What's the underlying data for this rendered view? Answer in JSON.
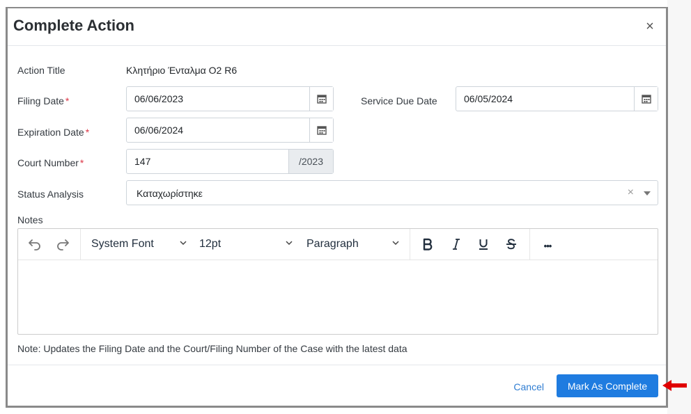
{
  "dialog": {
    "title": "Complete Action",
    "close_glyph": "×"
  },
  "form": {
    "action_title_label": "Action Title",
    "action_title_value": "Κλητήριο Ένταλμα Ο2 R6",
    "filing_date_label": "Filing Date",
    "filing_date_value": "06/06/2023",
    "service_due_date_label": "Service Due Date",
    "service_due_date_value": "06/05/2024",
    "expiration_date_label": "Expiration Date",
    "expiration_date_value": "06/06/2024",
    "court_number_label": "Court Number",
    "court_number_value": "147",
    "court_number_suffix": "/2023",
    "status_analysis_label": "Status Analysis",
    "status_analysis_value": "Καταχωρίστηκε",
    "clear_glyph": "×",
    "required_mark": "*",
    "notes_label": "Notes"
  },
  "editor": {
    "font_family": "System Font",
    "font_size": "12pt",
    "block_format": "Paragraph",
    "more_glyph": "•••",
    "icons": [
      "undo-icon",
      "redo-icon",
      "bold-icon",
      "italic-icon",
      "underline-icon",
      "strikethrough-icon",
      "more-icon"
    ]
  },
  "note_text": "Note: Updates the Filing Date and the Court/Filing Number of the Case with the latest data",
  "footer": {
    "cancel_label": "Cancel",
    "submit_label": "Mark As Complete"
  },
  "colors": {
    "primary": "#1f7ce0",
    "link": "#2f7dd2",
    "required": "#dc3545",
    "annotation_arrow": "#e00000"
  }
}
